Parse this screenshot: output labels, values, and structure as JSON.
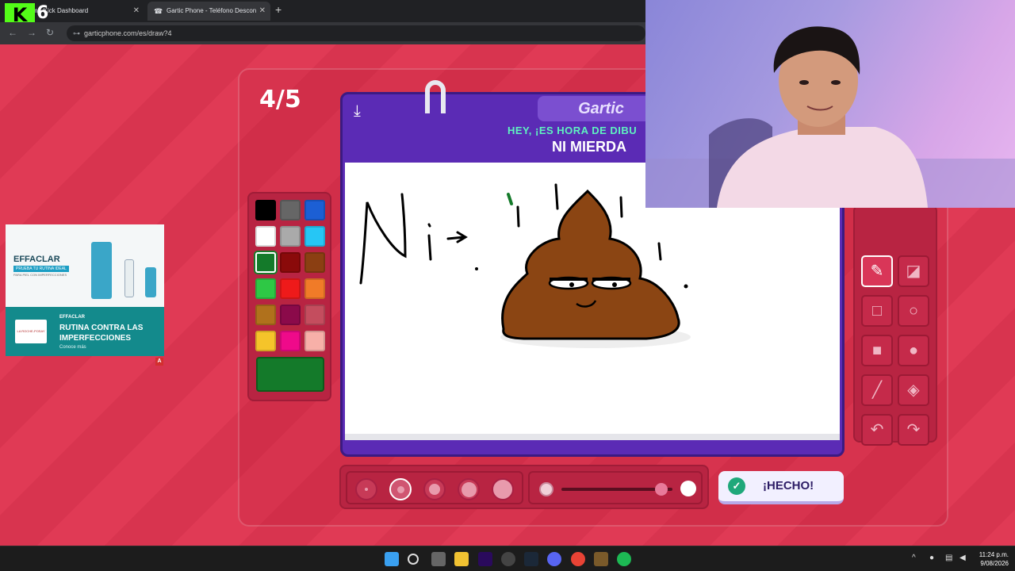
{
  "browser": {
    "tabs": [
      {
        "title": "eam - Kick Dashboard",
        "close": "✕"
      },
      {
        "title": "Gartic Phone - Teléfono Descon",
        "close": "✕",
        "favicon": "☎"
      }
    ],
    "new_tab": "+",
    "kick_logo": "K",
    "kick_number": "6",
    "url": "garticphone.com/es/draw?4",
    "nav": {
      "back": "←",
      "forward": "→",
      "reload": "↻"
    }
  },
  "game": {
    "round": "4/5",
    "logo": "Gartic",
    "prompt": "HEY, ¡ES HORA DE DIBU",
    "word": "NI MIERDA",
    "download_icon": "⤓",
    "done_label": "¡HECHO!",
    "done_check": "✓",
    "palette": [
      "#000000",
      "#666666",
      "#1c5fd4",
      "#ffffff",
      "#aaaaaa",
      "#26c6f5",
      "#147a2a",
      "#8a0a0a",
      "#8b3f12",
      "#2ec845",
      "#ee1a1a",
      "#f07b28",
      "#b0711c",
      "#8b0a4a",
      "#c44d5e",
      "#f5c42a",
      "#ef0a8a",
      "#f7b0a8"
    ],
    "selected_color": "#147a2a",
    "brush_sizes_count": 5,
    "selected_size_index": 1,
    "opacity_value": 0.9,
    "tools": [
      {
        "name": "pen",
        "glyph": "✎",
        "active": true
      },
      {
        "name": "eraser",
        "glyph": "◪",
        "active": false
      },
      {
        "name": "rectangle-outline",
        "glyph": "□",
        "active": false
      },
      {
        "name": "ellipse-outline",
        "glyph": "○",
        "active": false
      },
      {
        "name": "rectangle-fill",
        "glyph": "■",
        "active": false
      },
      {
        "name": "ellipse-fill",
        "glyph": "●",
        "active": false
      },
      {
        "name": "line",
        "glyph": "╱",
        "active": false
      },
      {
        "name": "fill-bucket",
        "glyph": "◈",
        "active": false
      },
      {
        "name": "undo",
        "glyph": "↶",
        "active": false
      },
      {
        "name": "redo",
        "glyph": "↷",
        "active": false
      }
    ]
  },
  "ad": {
    "brand": "EFFACLAR",
    "tagline": "PRUEBA TU RUTINA IDEAL",
    "tiny": "PARA PIEL CON IMPERFECCIONES",
    "logo_text": "LA ROCHE-POSAY",
    "small_brand": "EFFACLAR",
    "headline": "RUTINA CONTRA LAS IMPERFECCIONES",
    "cta": "Conoce más",
    "badge": "A"
  },
  "taskbar": {
    "time": "11:24 p.m.",
    "date": "9/08/2026",
    "tray_chevron": "^"
  }
}
